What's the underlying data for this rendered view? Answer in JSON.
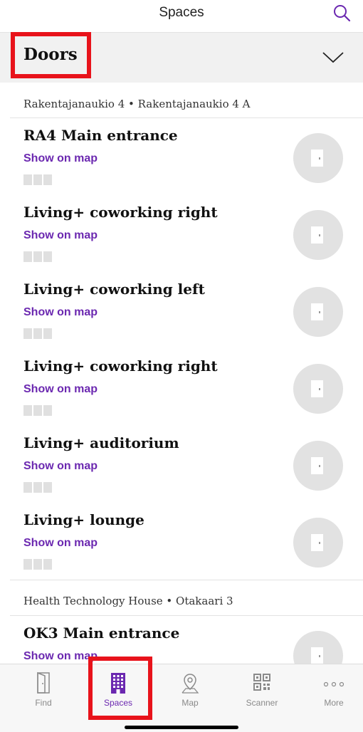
{
  "header": {
    "title": "Spaces",
    "search_icon": "search-icon"
  },
  "section": {
    "label": "Doors",
    "chevron_icon": "chevron-down-icon"
  },
  "groups": [
    {
      "name": "Rakentajanaukio 4 • Rakentajanaukio 4 A",
      "doors": [
        {
          "name": "RA4 Main entrance",
          "map_link": "Show on map"
        },
        {
          "name": "Living+ coworking right",
          "map_link": "Show on map"
        },
        {
          "name": "Living+ coworking left",
          "map_link": "Show on map"
        },
        {
          "name": "Living+ coworking right",
          "map_link": "Show on map"
        },
        {
          "name": "Living+ auditorium",
          "map_link": "Show on map"
        },
        {
          "name": "Living+ lounge",
          "map_link": "Show on map"
        }
      ]
    },
    {
      "name": "Health Technology House • Otakaari 3",
      "doors": [
        {
          "name": "OK3 Main entrance",
          "map_link": "Show on map"
        }
      ]
    }
  ],
  "tabbar": {
    "tabs": [
      {
        "label": "Find",
        "icon": "door-icon"
      },
      {
        "label": "Spaces",
        "icon": "building-icon"
      },
      {
        "label": "Map",
        "icon": "map-pin-icon"
      },
      {
        "label": "Scanner",
        "icon": "qr-code-icon"
      },
      {
        "label": "More",
        "icon": "more-dots-icon"
      }
    ]
  },
  "colors": {
    "accent": "#6b28b0",
    "highlight": "#e8131b",
    "section_bg": "#f1f1f1"
  }
}
